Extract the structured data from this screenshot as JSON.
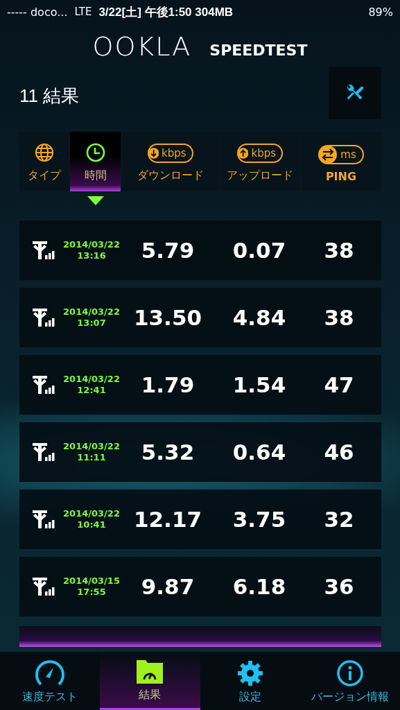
{
  "status_bar": {
    "carrier": "----- doco...",
    "network": "LTE",
    "datetime": "3/22[土] 午後1:50 304MB",
    "battery": "89%"
  },
  "header": {
    "logo": "OOKLA",
    "product": "SPEEDTEST"
  },
  "title": "11 結果",
  "sort_columns": [
    {
      "kind": "type",
      "label": "タイプ",
      "selected": false
    },
    {
      "kind": "time",
      "label": "時間",
      "selected": true
    },
    {
      "kind": "download",
      "label": "ダウンロード",
      "unit": "kbps",
      "selected": false
    },
    {
      "kind": "upload",
      "label": "アップロード",
      "unit": "kbps",
      "selected": false
    },
    {
      "kind": "ping",
      "label": "PING",
      "unit": "ms",
      "selected": false
    }
  ],
  "results": [
    {
      "date": "2014/03/22",
      "time": "13:16",
      "download": "5.79",
      "upload": "0.07",
      "ping": "38"
    },
    {
      "date": "2014/03/22",
      "time": "13:07",
      "download": "13.50",
      "upload": "4.84",
      "ping": "38"
    },
    {
      "date": "2014/03/22",
      "time": "12:41",
      "download": "1.79",
      "upload": "1.54",
      "ping": "47"
    },
    {
      "date": "2014/03/22",
      "time": "11:11",
      "download": "5.32",
      "upload": "0.64",
      "ping": "46"
    },
    {
      "date": "2014/03/22",
      "time": "10:41",
      "download": "12.17",
      "upload": "3.75",
      "ping": "32"
    },
    {
      "date": "2014/03/15",
      "time": "17:55",
      "download": "9.87",
      "upload": "6.18",
      "ping": "36"
    }
  ],
  "tabs": [
    {
      "kind": "speed",
      "label": "速度テスト",
      "selected": false
    },
    {
      "kind": "results",
      "label": "結果",
      "selected": true
    },
    {
      "kind": "settings",
      "label": "設定",
      "selected": false
    },
    {
      "kind": "info",
      "label": "バージョン情報",
      "selected": false
    }
  ]
}
